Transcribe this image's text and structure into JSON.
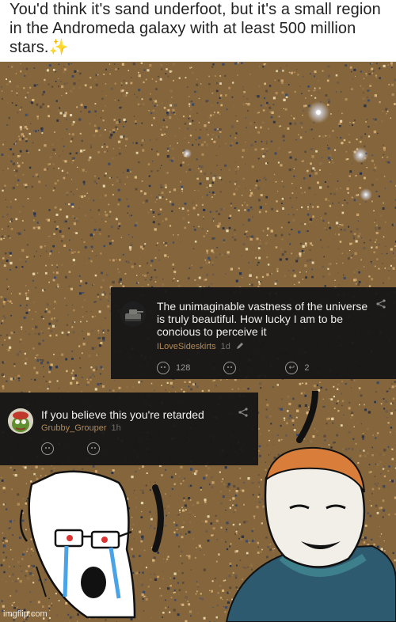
{
  "caption": {
    "text": "You'd think it's sand underfoot, but it's a small region in the Andromeda galaxy with at least 500 million stars.",
    "sparkle_glyph": "✨"
  },
  "comments": [
    {
      "text": "The unimaginable vastness of the universe is truly beautiful. How lucky I am to be concious to perceive it",
      "username": "ILoveSideskirts",
      "time": "1d",
      "upvotes": "128",
      "replies": "2"
    },
    {
      "text": "If you believe this you're retarded",
      "username": "Grubby_Grouper",
      "time": "1h"
    }
  ],
  "watermark": "imgflip.com",
  "colors": {
    "comment_bg": "#161616",
    "username": "#b48a52",
    "galaxy_base": "#8a6a3e"
  },
  "icons": [
    "share-icon",
    "edit-icon",
    "upvote-face-icon",
    "downvote-face-icon",
    "reply-icon",
    "sparkles-icon"
  ]
}
